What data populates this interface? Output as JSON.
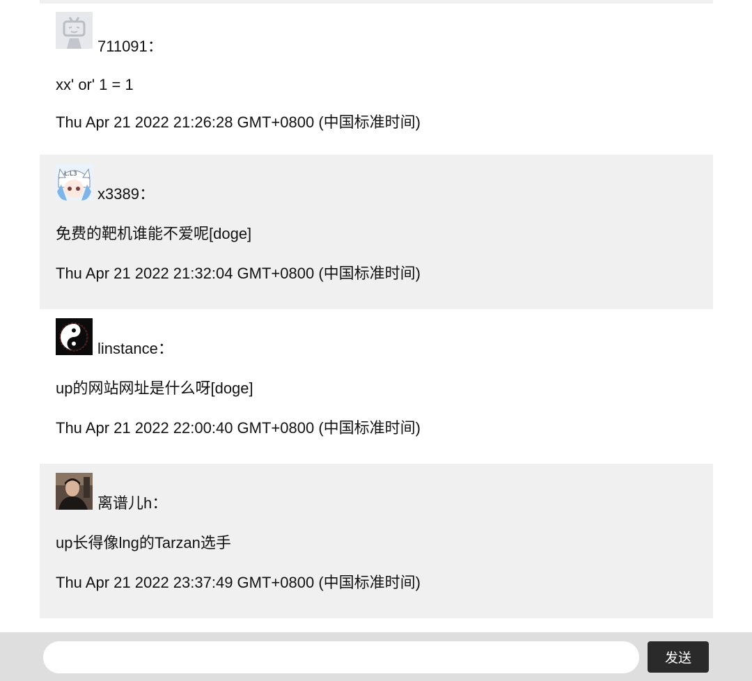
{
  "comments": [
    {
      "username": "711091：",
      "content": "xx' or' 1 = 1",
      "time": "Thu Apr 21 2022 21:26:28 GMT+0800 (中国标准时间)",
      "avatar_icon": "default-tv-mascot-avatar"
    },
    {
      "username": "x3389：",
      "content": "免费的靶机谁能不爱呢[doge]",
      "time": "Thu Apr 21 2022 21:32:04 GMT+0800 (中国标准时间)",
      "avatar_icon": "anime-character-avatar"
    },
    {
      "username": "linstance：",
      "content": "up的网站网址是什么呀[doge]",
      "time": "Thu Apr 21 2022 22:00:40 GMT+0800 (中国标准时间)",
      "avatar_icon": "yin-yang-avatar"
    },
    {
      "username": "离谱儿h：",
      "content": "up长得像lng的Tarzan选手",
      "time": "Thu Apr 21 2022 23:37:49 GMT+0800 (中国标准时间)",
      "avatar_icon": "person-photo-avatar"
    }
  ],
  "input": {
    "value": "",
    "placeholder": ""
  },
  "send_label": "发送",
  "colors": {
    "shaded_row": "#f0f0f0",
    "bottom_bar": "#dedede",
    "send_button": "#2a2a2a"
  }
}
